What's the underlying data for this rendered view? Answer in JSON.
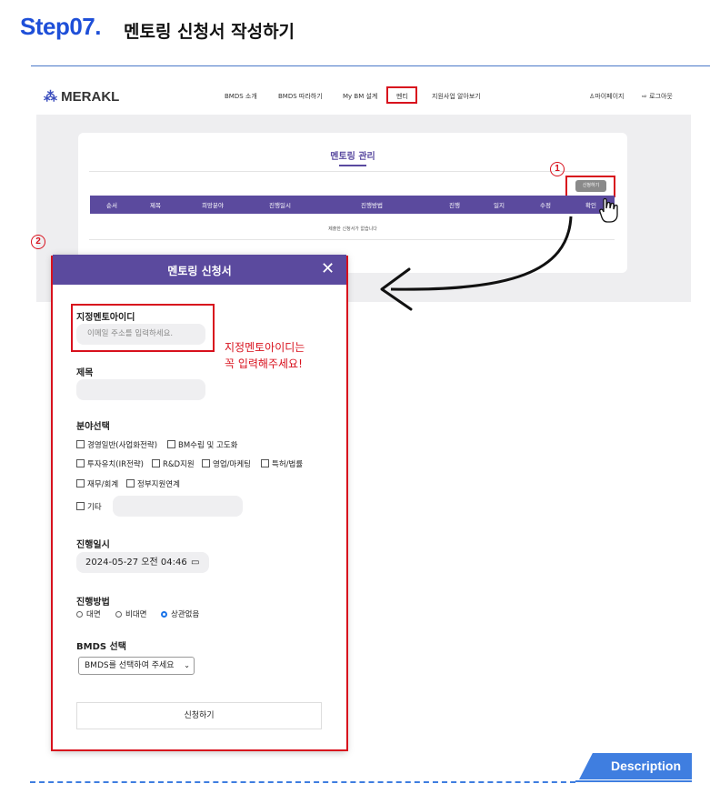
{
  "header": {
    "step": "Step07.",
    "title": "멘토링 신청서 작성하기"
  },
  "app": {
    "logo": "MERAKL",
    "nav": [
      "BMDS 소개",
      "BMDS 따라하기",
      "My BM 설계",
      "멘티",
      "지원사업 알아보기"
    ],
    "user_links": [
      "마이페이지",
      "로그아웃"
    ]
  },
  "panel": {
    "title": "멘토링 관리",
    "apply_button": "신청하기",
    "columns": [
      "순서",
      "제목",
      "희망분야",
      "진행일시",
      "진행방법",
      "진행",
      "일지",
      "수정",
      "확인"
    ],
    "empty_message": "제출한 신청서가 없습니다"
  },
  "markers": [
    "1",
    "2"
  ],
  "modal": {
    "title": "멘토링 신청서",
    "close": "✕",
    "mentor_id_label": "지정멘토아이디",
    "mentor_id_placeholder": "이메일 주소를 입력하세요.",
    "subject_label": "제목",
    "subject_value": "",
    "field_label": "분야선택",
    "fields": [
      "경영일반(사업화전략)",
      "BM수립 및 고도화",
      "투자유치(IR전략)",
      "R&D지원",
      "영업/마케팅",
      "특허/법률",
      "재무/회계",
      "정부지원연계",
      "기타"
    ],
    "date_label": "진행일시",
    "date_value": "2024-05-27 오전 04:46",
    "method_label": "진행방법",
    "methods": [
      "대면",
      "비대면",
      "상관없음"
    ],
    "method_selected": "상관없음",
    "bmds_label": "BMDS 선택",
    "bmds_select": "BMDS를 선택하여 주세요",
    "submit": "신청하기"
  },
  "note": [
    "지정멘토아이디는",
    "꼭 입력해주세요!"
  ],
  "description_tab": "Description",
  "colors": {
    "accent_blue": "#1e4fd8",
    "brand_purple": "#5b4a9e",
    "highlight_red": "#d8111d"
  }
}
